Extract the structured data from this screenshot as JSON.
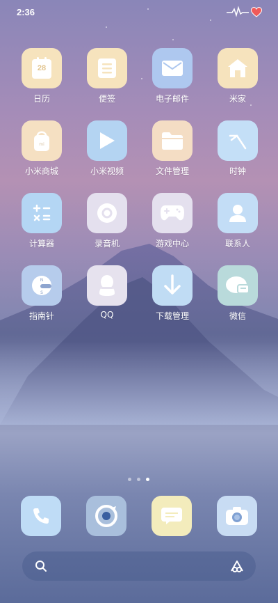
{
  "status_bar": {
    "time": "2:36"
  },
  "apps": [
    {
      "label": "日历",
      "icon": "calendar-icon",
      "color": "#f6e3bd",
      "day": "28"
    },
    {
      "label": "便签",
      "icon": "notes-icon",
      "color": "#f6e3bd"
    },
    {
      "label": "电子邮件",
      "icon": "email-icon",
      "color": "#aec8ef"
    },
    {
      "label": "米家",
      "icon": "home-icon",
      "color": "#f6e3bd"
    },
    {
      "label": "小米商城",
      "icon": "shopping-bag-icon",
      "color": "#f5e0c2"
    },
    {
      "label": "小米视频",
      "icon": "play-icon",
      "color": "#b4d4f2"
    },
    {
      "label": "文件管理",
      "icon": "folder-icon",
      "color": "#f4ddc4"
    },
    {
      "label": "时钟",
      "icon": "clock-icon",
      "color": "#c4dff7"
    },
    {
      "label": "计算器",
      "icon": "calculator-icon",
      "color": "#b4d6f4"
    },
    {
      "label": "录音机",
      "icon": "recorder-icon",
      "color": "#e4e0ee"
    },
    {
      "label": "游戏中心",
      "icon": "gamepad-icon",
      "color": "#e4e0ee"
    },
    {
      "label": "联系人",
      "icon": "contact-icon",
      "color": "#c3ddf6"
    },
    {
      "label": "指南针",
      "icon": "compass-icon",
      "color": "#b6ccec"
    },
    {
      "label": "QQ",
      "icon": "penguin-icon",
      "color": "#e6e2ee"
    },
    {
      "label": "下载管理",
      "icon": "download-icon",
      "color": "#c0dcf4"
    },
    {
      "label": "微信",
      "icon": "chat-icon",
      "color": "#b9dadb"
    }
  ],
  "dock": [
    {
      "icon": "phone-icon",
      "color": "#bfdcf6"
    },
    {
      "icon": "browser-icon",
      "color": "#a9bfdc"
    },
    {
      "icon": "message-icon",
      "color": "#f3ecbc"
    },
    {
      "icon": "camera-icon",
      "color": "#c8dcf3"
    }
  ],
  "page_indicator": {
    "pages": 3,
    "current": 3
  }
}
